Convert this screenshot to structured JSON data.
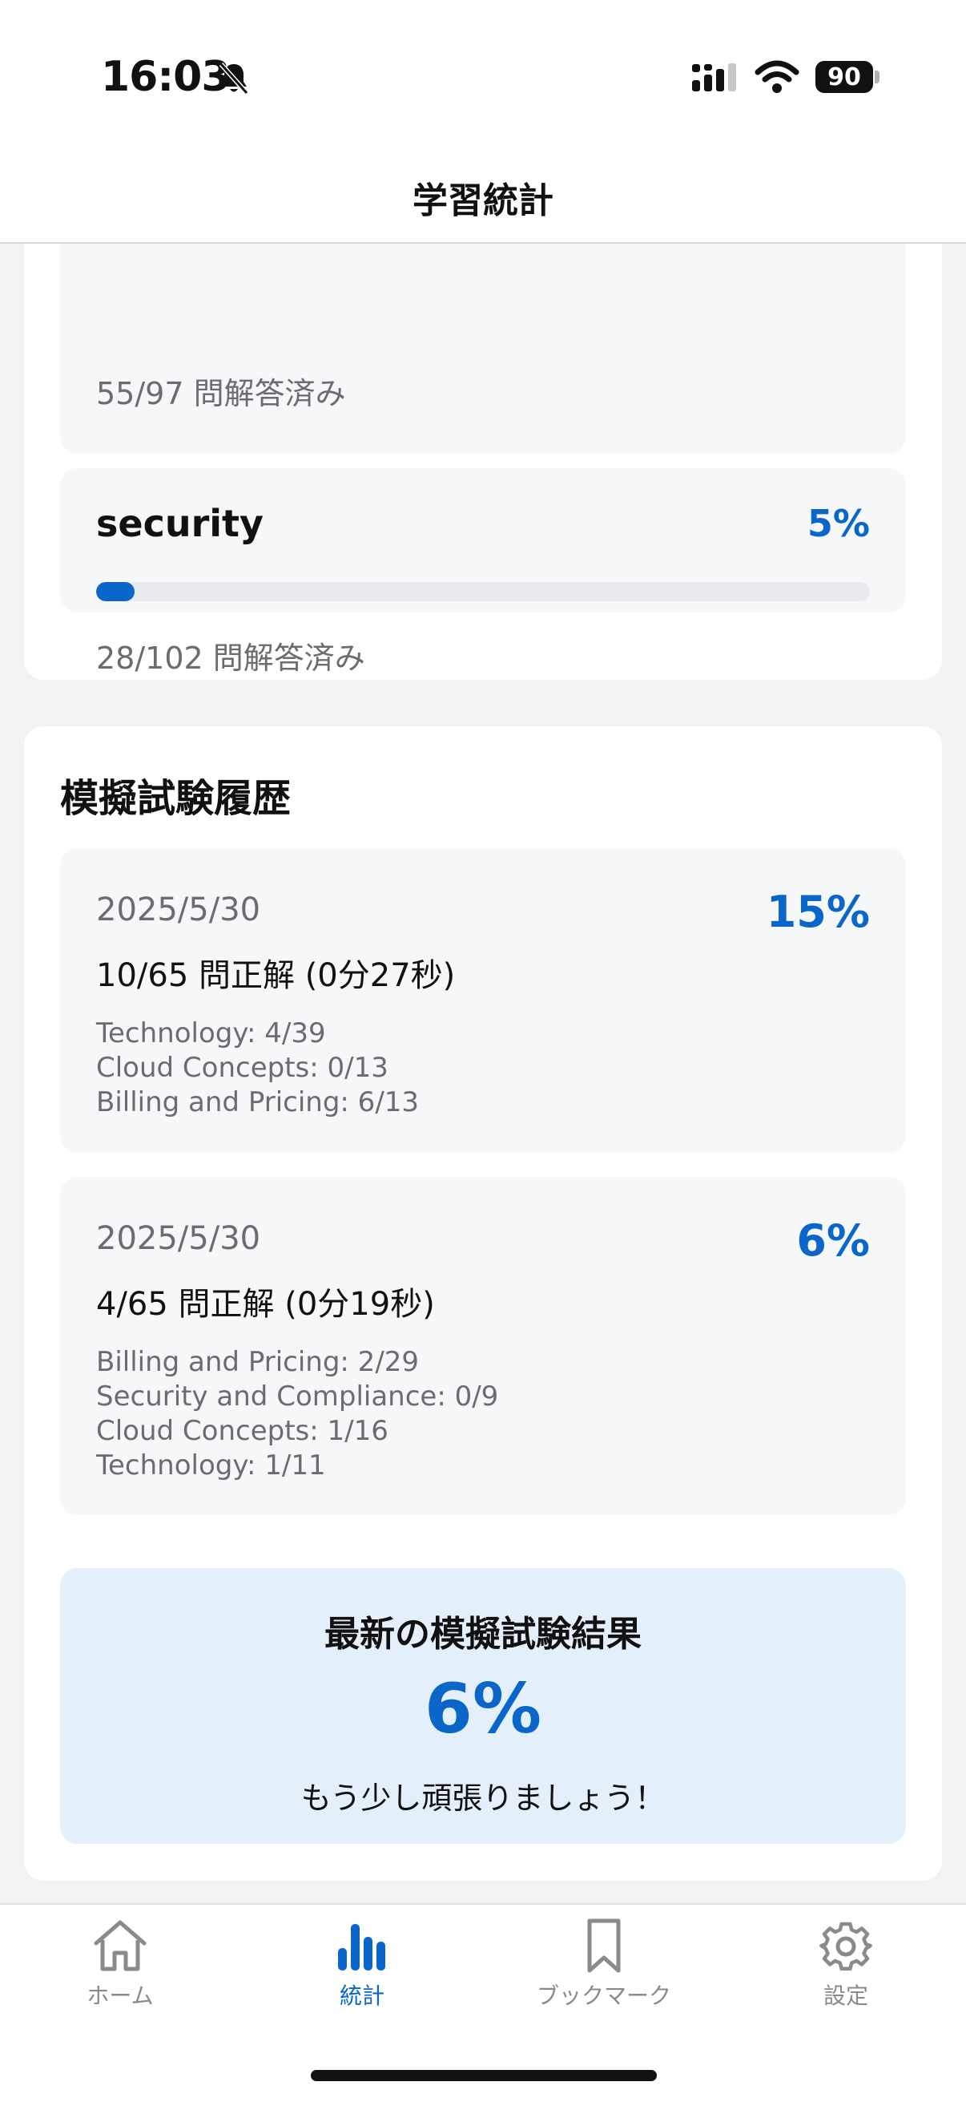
{
  "status_bar": {
    "time": "16:03",
    "battery": "90"
  },
  "header": {
    "title": "学習統計"
  },
  "categories_card": {
    "previous_item_answered": "55/97 問解答済み",
    "items": [
      {
        "name": "security",
        "percent_label": "5%",
        "progress": 0.05,
        "answered": "28/102 問解答済み"
      }
    ]
  },
  "history": {
    "title": "模擬試験履歴",
    "exams": [
      {
        "date": "2025/5/30",
        "percent": "15%",
        "summary": "10/65 問正解 (0分27秒)",
        "breakdown": [
          "Technology: 4/39",
          "Cloud Concepts: 0/13",
          "Billing and Pricing: 6/13"
        ]
      },
      {
        "date": "2025/5/30",
        "percent": "6%",
        "summary": "4/65 問正解 (0分19秒)",
        "breakdown": [
          "Billing and Pricing: 2/29",
          "Security and Compliance: 0/9",
          "Cloud Concepts: 1/16",
          "Technology: 1/11"
        ]
      }
    ],
    "latest": {
      "title": "最新の模擬試験結果",
      "percent": "6%",
      "message": "もう少し頑張りましょう！"
    }
  },
  "tab_bar": {
    "accent_color": "#0a66c8",
    "tabs": [
      {
        "label": "ホーム",
        "icon": "home-icon",
        "active": false
      },
      {
        "label": "統計",
        "icon": "stats-icon",
        "active": true
      },
      {
        "label": "ブックマーク",
        "icon": "bookmark-icon",
        "active": false
      },
      {
        "label": "設定",
        "icon": "gear-icon",
        "active": false
      }
    ]
  }
}
